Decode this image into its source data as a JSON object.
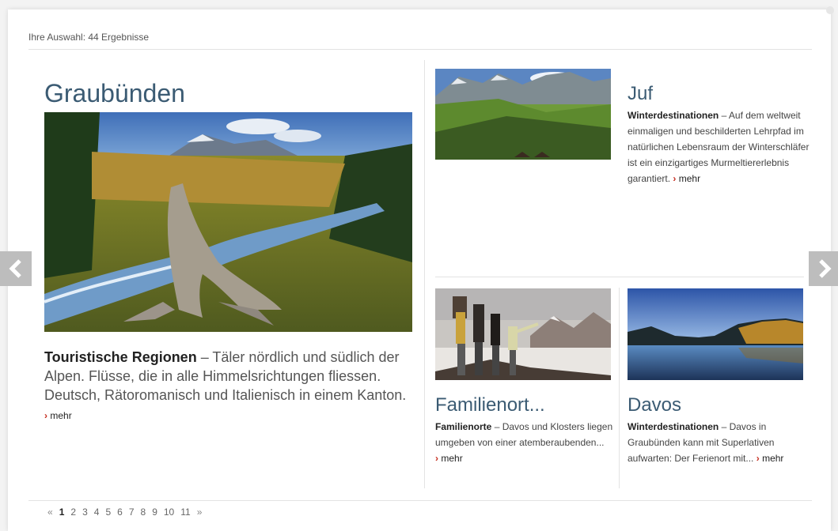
{
  "results_label": "Ihre Auswahl: 44 Ergebnisse",
  "featured": {
    "title": "Graubünden",
    "lead": "Touristische Regionen",
    "text": " – Täler nördlich und südlich der Alpen. Flüsse, die in alle Himmelsrichtungen fliessen. Deutsch, Rätoromanisch und Italienisch in einem Kanton. ",
    "more": "mehr"
  },
  "cards": {
    "juf": {
      "title": "Juf",
      "lead": "Winterdestinationen",
      "text": " – Auf dem weltweit einmaligen und beschilderten Lehrpfad im natürlichen Lebensraum der Winterschläfer ist ein einzigartiges Murmeltiererlebnis garantiert. ",
      "more": "mehr"
    },
    "family": {
      "title": "Familienort...",
      "lead": "Familienorte",
      "text": " – Davos und Klosters liegen umgeben von einer atemberaubenden... ",
      "more": "mehr"
    },
    "davos": {
      "title": "Davos",
      "lead": "Winterdestinationen",
      "text": " – Davos in Graubünden kann mit Superlativen aufwarten: Der Ferienort mit... ",
      "more": "mehr"
    }
  },
  "pagination": {
    "prev": "«",
    "next": "»",
    "pages": [
      "1",
      "2",
      "3",
      "4",
      "5",
      "6",
      "7",
      "8",
      "9",
      "10",
      "11"
    ],
    "current": "1"
  },
  "colors": {
    "title_blue": "#3b5b73",
    "more_red": "#c62d1f",
    "arrow_gray": "#bdbdbd"
  },
  "icons": {
    "prev": "chevron-left-icon",
    "next": "chevron-right-icon",
    "more": "chevron-right-icon"
  }
}
